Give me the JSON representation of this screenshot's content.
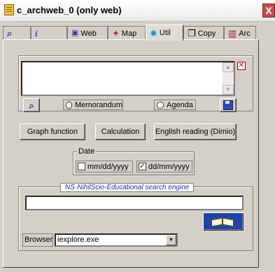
{
  "window": {
    "title": "c_archweb_0 (only web)",
    "close_glyph": "X"
  },
  "tabs": [
    {
      "label": "",
      "icon": "search-icon"
    },
    {
      "label": "",
      "icon": "info-icon"
    },
    {
      "label": "Web",
      "icon": "network-icon"
    },
    {
      "label": "Map",
      "icon": "map-icon"
    },
    {
      "label": "Util",
      "icon": "util-icon",
      "active": true
    },
    {
      "label": "Copy",
      "icon": "copy-icon"
    },
    {
      "label": "Arc",
      "icon": "archive-icon"
    }
  ],
  "notes": {
    "memorandum_label": "Memorandum",
    "agenda_label": "Agenda"
  },
  "tools": {
    "graph_label": "Graph function",
    "calc_label": "Calculation",
    "english_label": "English reading (Dimio)"
  },
  "date": {
    "group_label": "Date",
    "option_mmddyyyy": "mm/dd/yyyy",
    "option_ddmmyyyy": "dd/mm/yyyy",
    "ddmmyyyy_checked": true
  },
  "search": {
    "group_label": "NS-NihilScio-Educational search engine",
    "browser_label": "Browser",
    "browser_value": "iexplore.exe"
  },
  "colors": {
    "active_tab_icon": "#1a9ad6",
    "close_button": "#c14d4d",
    "link_text": "#1f2fb0"
  }
}
